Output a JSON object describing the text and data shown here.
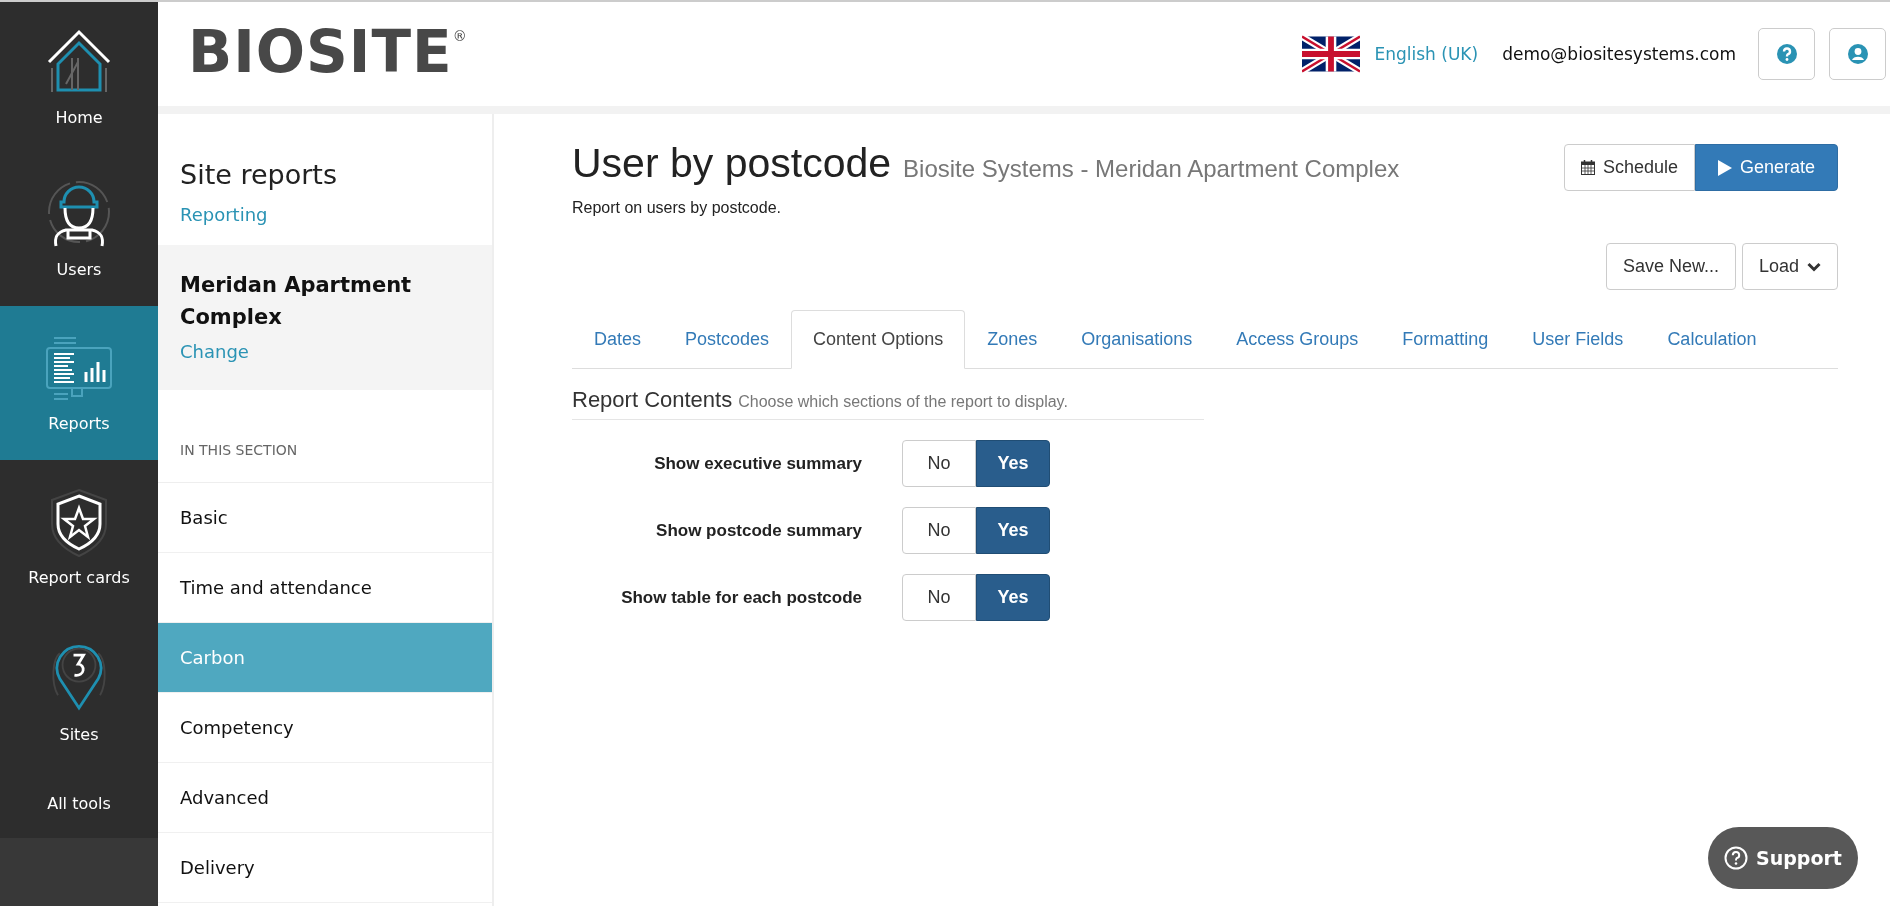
{
  "rail": [
    {
      "label": "Home",
      "selected": false
    },
    {
      "label": "Users",
      "selected": false
    },
    {
      "label": "Reports",
      "selected": true
    },
    {
      "label": "Report cards",
      "selected": false
    },
    {
      "label": "Sites",
      "selected": false
    },
    {
      "label": "All tools",
      "selected": false
    }
  ],
  "header": {
    "logo": "BIOSITE",
    "logo_mark": "®",
    "language": "English (UK)",
    "user": "demo@biositesystems.com"
  },
  "sidebar": {
    "title": "Site reports",
    "link": "Reporting",
    "site": "Meridan Apartment Complex",
    "site_link": "Change",
    "section_heading": "IN THIS SECTION",
    "items": [
      {
        "label": "Basic",
        "selected": false
      },
      {
        "label": "Time and attendance",
        "selected": false
      },
      {
        "label": "Carbon",
        "selected": true
      },
      {
        "label": "Competency",
        "selected": false
      },
      {
        "label": "Advanced",
        "selected": false
      },
      {
        "label": "Delivery",
        "selected": false
      }
    ]
  },
  "report": {
    "title": "User by postcode",
    "subtitle": "Biosite Systems - Meridan Apartment Complex",
    "description": "Report on users by postcode.",
    "schedule_button": "Schedule",
    "generate_button": "Generate",
    "save_button": "Save New...",
    "load_button": "Load"
  },
  "tabs": [
    {
      "label": "Dates",
      "selected": false
    },
    {
      "label": "Postcodes",
      "selected": false
    },
    {
      "label": "Content Options",
      "selected": true
    },
    {
      "label": "Zones",
      "selected": false
    },
    {
      "label": "Organisations",
      "selected": false
    },
    {
      "label": "Access Groups",
      "selected": false
    },
    {
      "label": "Formatting",
      "selected": false
    },
    {
      "label": "User Fields",
      "selected": false
    },
    {
      "label": "Calculation",
      "selected": false
    }
  ],
  "section": {
    "title": "Report Contents",
    "hint": "Choose which sections of the report to display."
  },
  "options": [
    {
      "label": "Show executive summary",
      "choices": [
        {
          "label": "No",
          "selected": false
        },
        {
          "label": "Yes",
          "selected": true
        }
      ]
    },
    {
      "label": "Show postcode summary",
      "choices": [
        {
          "label": "No",
          "selected": false
        },
        {
          "label": "Yes",
          "selected": true
        }
      ]
    },
    {
      "label": "Show table for each postcode",
      "choices": [
        {
          "label": "No",
          "selected": false
        },
        {
          "label": "Yes",
          "selected": true
        }
      ]
    }
  ],
  "support_button": "Support"
}
